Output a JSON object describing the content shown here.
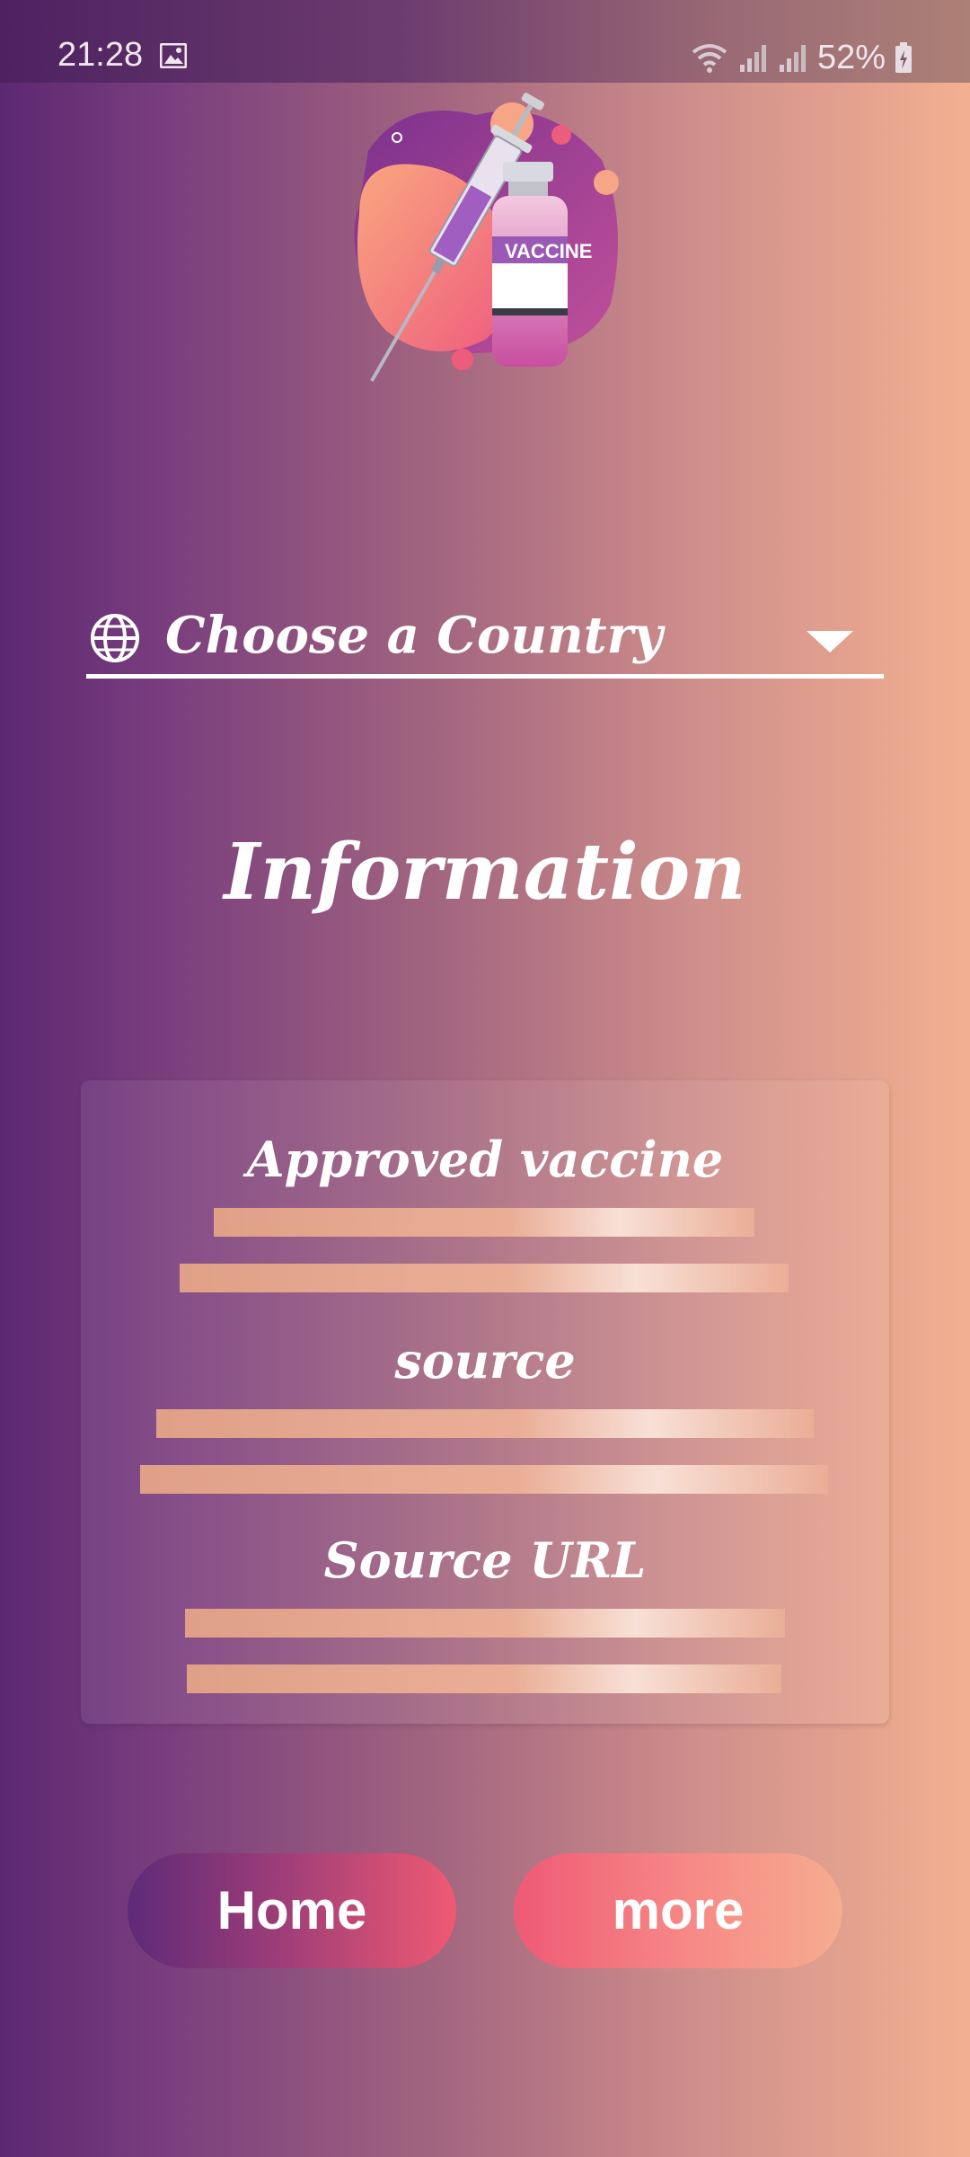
{
  "status_bar": {
    "time": "21:28",
    "battery": "52%",
    "icons": [
      "image-icon",
      "wifi-icon",
      "signal-icon",
      "battery-icon"
    ]
  },
  "hero": {
    "icon": "vaccine-illustration",
    "vial_label": "VACCINE"
  },
  "country_select": {
    "label": "Choose a Country",
    "icon": "globe-icon"
  },
  "info": {
    "heading": "Information",
    "approved_label": "Approved vaccine",
    "source_label": "source",
    "source_url_label": "Source URL"
  },
  "buttons": {
    "home_label": "Home",
    "more_label": "more"
  },
  "colors": {
    "accent_pink": "#ef5a73",
    "accent_purple": "#5e2a78",
    "peach": "#f3b091"
  }
}
